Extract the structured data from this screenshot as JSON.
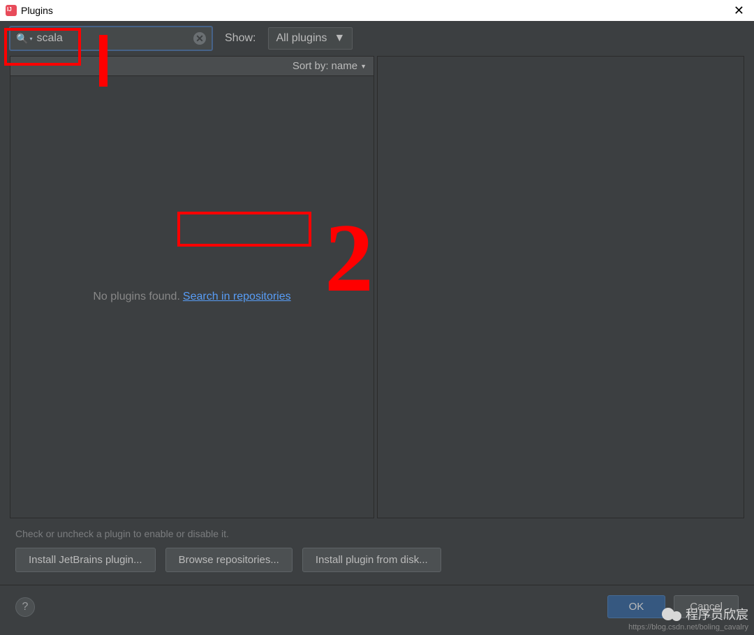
{
  "window": {
    "title": "Plugins"
  },
  "toolbar": {
    "search_value": "scala",
    "show_label": "Show:",
    "show_selected": "All plugins"
  },
  "list": {
    "sort_label": "Sort by:",
    "sort_value": "name",
    "empty_text": "No plugins found.",
    "search_repos_link": "Search in repositories"
  },
  "hint": "Check or uncheck a plugin to enable or disable it.",
  "buttons": {
    "install_jb": "Install JetBrains plugin...",
    "browse_repos": "Browse repositories...",
    "install_disk": "Install plugin from disk...",
    "ok": "OK",
    "cancel": "Cancel",
    "help": "?"
  },
  "annotations": {
    "num2": "2"
  },
  "watermark": {
    "name": "程序员欣宸",
    "url": "https://blog.csdn.net/boling_cavalry"
  }
}
